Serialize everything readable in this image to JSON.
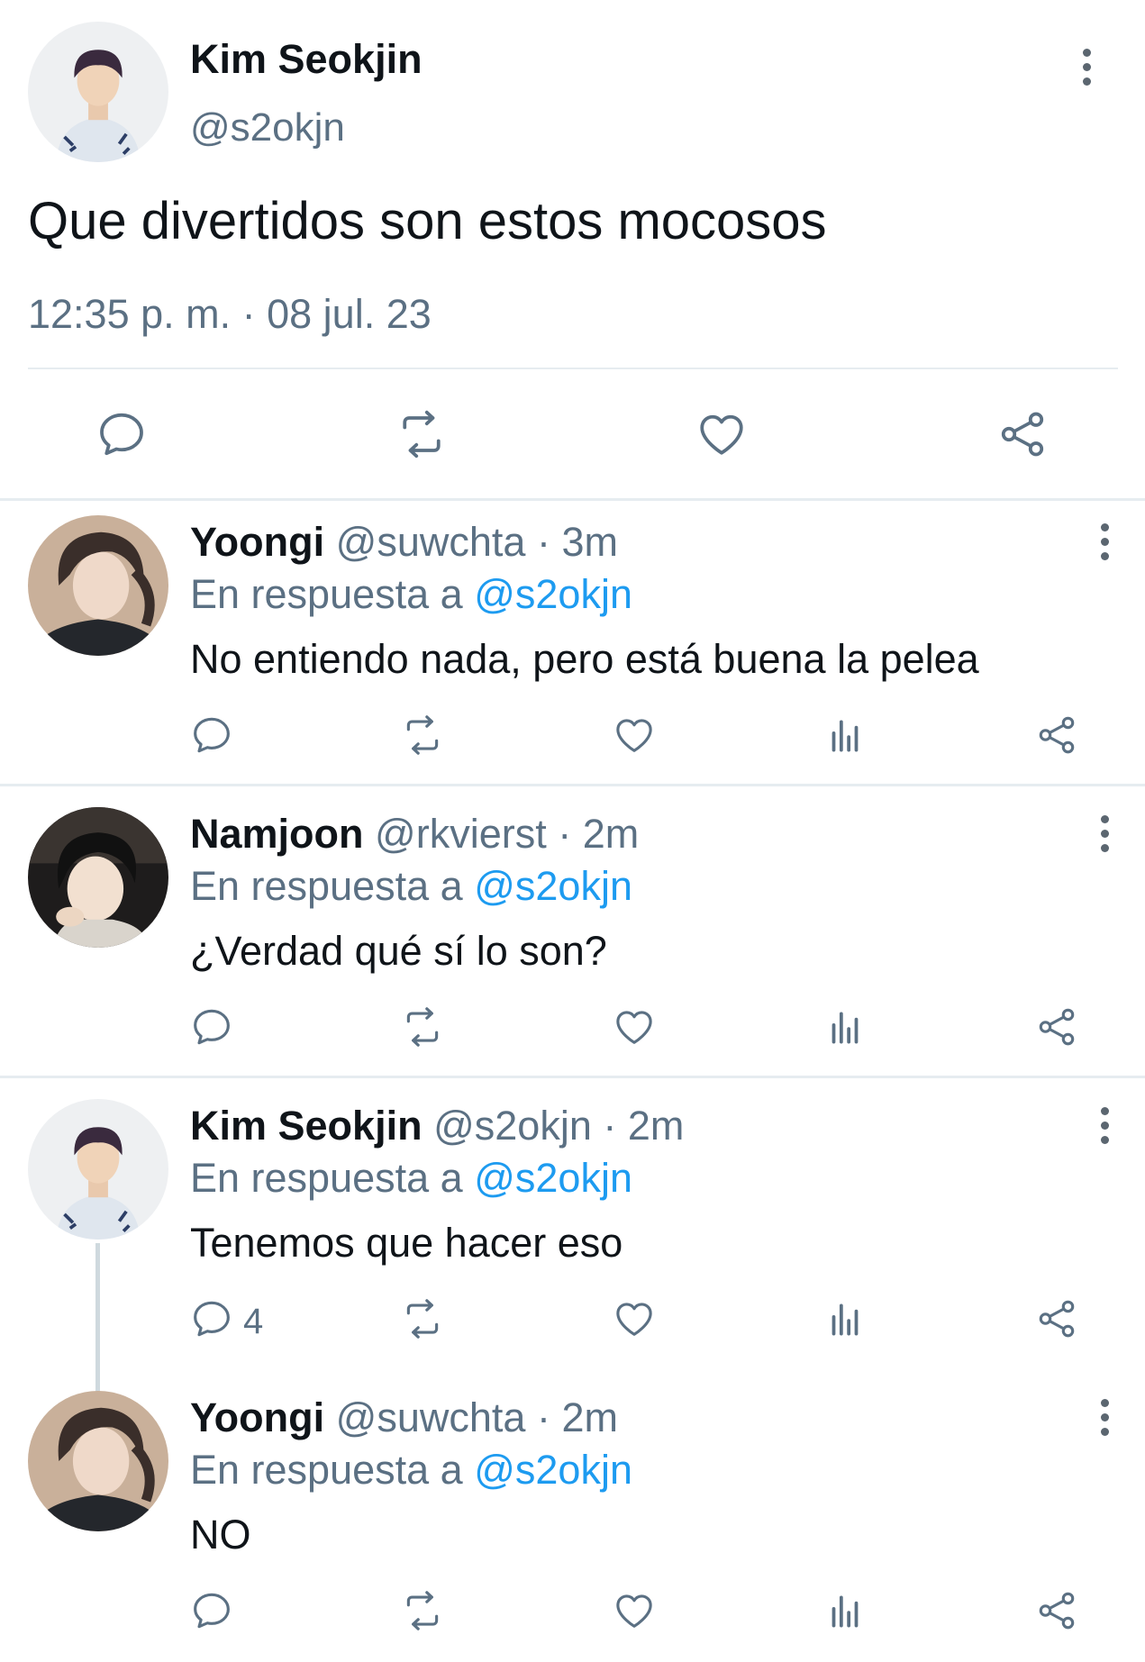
{
  "main_tweet": {
    "name": "Kim Seokjin",
    "handle": "@s2okjn",
    "text": "Que divertidos son estos mocosos",
    "timestamp": "12:35 p. m. · 08 jul. 23",
    "actions": [
      "reply-icon",
      "retweet-icon",
      "like-icon",
      "share-icon"
    ]
  },
  "replies": [
    {
      "name": "Yoongi",
      "handle": "@suwchta",
      "time": "3m",
      "reply_prefix": "En respuesta a",
      "reply_to": "@s2okjn",
      "text": "No entiendo nada, pero está buena la pelea",
      "reply_count": ""
    },
    {
      "name": "Namjoon",
      "handle": "@rkvierst",
      "time": "2m",
      "reply_prefix": "En respuesta a",
      "reply_to": "@s2okjn",
      "text": "¿Verdad qué sí lo son?",
      "reply_count": ""
    },
    {
      "name": "Kim Seokjin",
      "handle": "@s2okjn",
      "time": "2m",
      "reply_prefix": "En respuesta a",
      "reply_to": "@s2okjn",
      "text": "Tenemos que hacer eso",
      "reply_count": "4"
    },
    {
      "name": "Yoongi",
      "handle": "@suwchta",
      "time": "2m",
      "reply_prefix": "En respuesta a",
      "reply_to": "@s2okjn",
      "text": "NO",
      "reply_count": ""
    }
  ],
  "separator": "·",
  "colors": {
    "text": "#0f1419",
    "secondary": "#5b7083",
    "link": "#1d9bf0",
    "icon": "#5b7083",
    "divider": "#e6ecf0",
    "thread_line": "#cfd9de"
  }
}
